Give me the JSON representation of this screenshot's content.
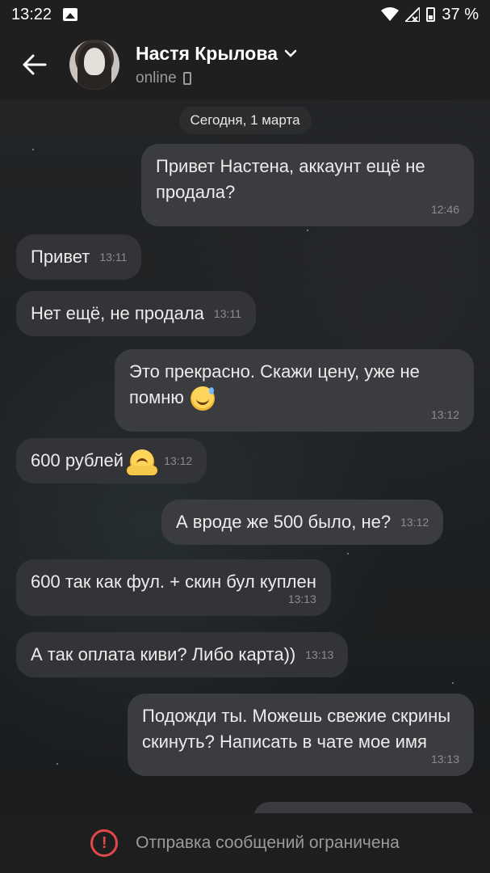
{
  "status_bar": {
    "time": "13:22",
    "battery": "37 %"
  },
  "header": {
    "contact_name": "Настя Крылова",
    "contact_status": "online"
  },
  "chat": {
    "date_separator": "Сегодня, 1 марта",
    "messages": [
      {
        "direction": "outgoing",
        "text": "Привет Настена, аккаунт ещё не продала?",
        "time": "12:46"
      },
      {
        "direction": "incoming",
        "text": "Привет",
        "time": "13:11"
      },
      {
        "direction": "incoming",
        "text": "Нет ещё, не продала",
        "time": "13:11"
      },
      {
        "direction": "outgoing",
        "text": "Это прекрасно. Скажи цену, уже не помню",
        "emoji": "sweat-smile",
        "time": "13:12"
      },
      {
        "direction": "incoming",
        "text": "600 рублей",
        "emoji": "hugging-face",
        "time": "13:12"
      },
      {
        "direction": "outgoing",
        "text": "А вроде же 500 было, не?",
        "time": "13:12"
      },
      {
        "direction": "incoming",
        "text": "600 так как фул. + скин бул куплен",
        "time": "13:13"
      },
      {
        "direction": "incoming",
        "text": "А так оплата киви? Либо карта))",
        "time": "13:13"
      },
      {
        "direction": "outgoing",
        "text": "Подожди ты. Можешь свежие скрины скинуть? Написать в чате мое имя",
        "time": "13:13"
      }
    ]
  },
  "bottom_bar": {
    "restriction_text": "Отправка сообщений ограничена"
  },
  "colors": {
    "background": "#1b1d20",
    "bubble_incoming": "#333437",
    "bubble_outgoing": "#3b3c3f",
    "alert": "#e0484a"
  }
}
